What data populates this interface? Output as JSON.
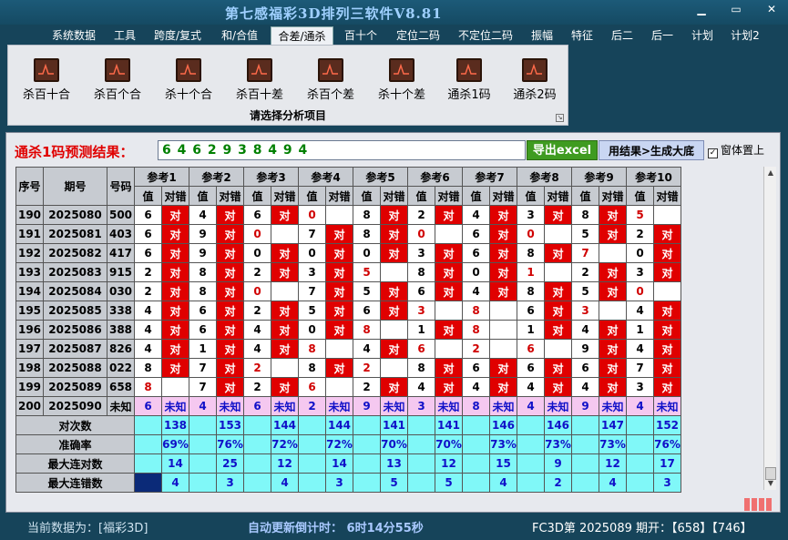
{
  "app": {
    "title": "第七感福彩3D排列三软件V8.81",
    "min_label": "▁",
    "restore_label": "▭",
    "close_label": "✕"
  },
  "menu": [
    "系统数据",
    "工具",
    "跨度/复式",
    "和/合值",
    "合差/通杀",
    "百十个",
    "定位二码",
    "不定位二码",
    "振幅",
    "特征",
    "后二",
    "后一",
    "计划",
    "计划2"
  ],
  "ribbon": {
    "buttons": [
      "杀百十合",
      "杀百个合",
      "杀十个合",
      "杀百十差",
      "杀百个差",
      "杀十个差",
      "通杀1码",
      "通杀2码"
    ],
    "caption": "请选择分析项目",
    "corner": "↘"
  },
  "prediction": {
    "label": "通杀1码预测结果：",
    "value": "6 4 6 2 9 3 8 4 9 4",
    "export_button": "导出excel",
    "result_button": "用结果>生成大底",
    "topmost_label": "窗体置上",
    "topmost_checked": "✓"
  },
  "table": {
    "h1": [
      "序号",
      "期号",
      "号码"
    ],
    "refs": [
      "参考1",
      "参考2",
      "参考3",
      "参考4",
      "参考5",
      "参考6",
      "参考7",
      "参考8",
      "参考9",
      "参考10"
    ],
    "sub": [
      "值",
      "对错"
    ],
    "rows": [
      {
        "seq": "190",
        "issue": "2025080",
        "num": "500",
        "cells": [
          [
            "6",
            "对"
          ],
          [
            "4",
            "对"
          ],
          [
            "6",
            "对"
          ],
          [
            "0",
            ""
          ],
          [
            "8",
            "对"
          ],
          [
            "2",
            "对"
          ],
          [
            "4",
            "对"
          ],
          [
            "3",
            "对"
          ],
          [
            "8",
            "对"
          ],
          [
            "5",
            ""
          ]
        ]
      },
      {
        "seq": "191",
        "issue": "2025081",
        "num": "403",
        "cells": [
          [
            "6",
            "对"
          ],
          [
            "9",
            "对"
          ],
          [
            "0",
            ""
          ],
          [
            "7",
            "对"
          ],
          [
            "8",
            "对"
          ],
          [
            "0",
            ""
          ],
          [
            "6",
            "对"
          ],
          [
            "0",
            ""
          ],
          [
            "5",
            "对"
          ],
          [
            "2",
            "对"
          ]
        ]
      },
      {
        "seq": "192",
        "issue": "2025082",
        "num": "417",
        "cells": [
          [
            "6",
            "对"
          ],
          [
            "9",
            "对"
          ],
          [
            "0",
            "对"
          ],
          [
            "0",
            "对"
          ],
          [
            "0",
            "对"
          ],
          [
            "3",
            "对"
          ],
          [
            "6",
            "对"
          ],
          [
            "8",
            "对"
          ],
          [
            "7",
            ""
          ],
          [
            "0",
            "对"
          ]
        ]
      },
      {
        "seq": "193",
        "issue": "2025083",
        "num": "915",
        "cells": [
          [
            "2",
            "对"
          ],
          [
            "8",
            "对"
          ],
          [
            "2",
            "对"
          ],
          [
            "3",
            "对"
          ],
          [
            "5",
            ""
          ],
          [
            "8",
            "对"
          ],
          [
            "0",
            "对"
          ],
          [
            "1",
            ""
          ],
          [
            "2",
            "对"
          ],
          [
            "3",
            "对"
          ]
        ]
      },
      {
        "seq": "194",
        "issue": "2025084",
        "num": "030",
        "cells": [
          [
            "2",
            "对"
          ],
          [
            "8",
            "对"
          ],
          [
            "0",
            ""
          ],
          [
            "7",
            "对"
          ],
          [
            "5",
            "对"
          ],
          [
            "6",
            "对"
          ],
          [
            "4",
            "对"
          ],
          [
            "8",
            "对"
          ],
          [
            "5",
            "对"
          ],
          [
            "0",
            ""
          ]
        ]
      },
      {
        "seq": "195",
        "issue": "2025085",
        "num": "338",
        "cells": [
          [
            "4",
            "对"
          ],
          [
            "6",
            "对"
          ],
          [
            "2",
            "对"
          ],
          [
            "5",
            "对"
          ],
          [
            "6",
            "对"
          ],
          [
            "3",
            ""
          ],
          [
            "8",
            ""
          ],
          [
            "6",
            "对"
          ],
          [
            "3",
            ""
          ],
          [
            "4",
            "对"
          ]
        ]
      },
      {
        "seq": "196",
        "issue": "2025086",
        "num": "388",
        "cells": [
          [
            "4",
            "对"
          ],
          [
            "6",
            "对"
          ],
          [
            "4",
            "对"
          ],
          [
            "0",
            "对"
          ],
          [
            "8",
            ""
          ],
          [
            "1",
            "对"
          ],
          [
            "8",
            ""
          ],
          [
            "1",
            "对"
          ],
          [
            "4",
            "对"
          ],
          [
            "1",
            "对"
          ]
        ]
      },
      {
        "seq": "197",
        "issue": "2025087",
        "num": "826",
        "cells": [
          [
            "4",
            "对"
          ],
          [
            "1",
            "对"
          ],
          [
            "4",
            "对"
          ],
          [
            "8",
            ""
          ],
          [
            "4",
            "对"
          ],
          [
            "6",
            ""
          ],
          [
            "2",
            ""
          ],
          [
            "6",
            ""
          ],
          [
            "9",
            "对"
          ],
          [
            "4",
            "对"
          ]
        ]
      },
      {
        "seq": "198",
        "issue": "2025088",
        "num": "022",
        "cells": [
          [
            "8",
            "对"
          ],
          [
            "7",
            "对"
          ],
          [
            "2",
            ""
          ],
          [
            "8",
            "对"
          ],
          [
            "2",
            ""
          ],
          [
            "8",
            "对"
          ],
          [
            "6",
            "对"
          ],
          [
            "6",
            "对"
          ],
          [
            "6",
            "对"
          ],
          [
            "7",
            "对"
          ]
        ]
      },
      {
        "seq": "199",
        "issue": "2025089",
        "num": "658",
        "cells": [
          [
            "8",
            ""
          ],
          [
            "7",
            "对"
          ],
          [
            "2",
            "对"
          ],
          [
            "6",
            ""
          ],
          [
            "2",
            "对"
          ],
          [
            "4",
            "对"
          ],
          [
            "4",
            "对"
          ],
          [
            "4",
            "对"
          ],
          [
            "4",
            "对"
          ],
          [
            "3",
            "对"
          ]
        ]
      },
      {
        "seq": "200",
        "issue": "2025090",
        "num": "未知",
        "cells": [
          [
            "6",
            "未知"
          ],
          [
            "4",
            "未知"
          ],
          [
            "6",
            "未知"
          ],
          [
            "2",
            "未知"
          ],
          [
            "9",
            "未知"
          ],
          [
            "3",
            "未知"
          ],
          [
            "8",
            "未知"
          ],
          [
            "4",
            "未知"
          ],
          [
            "9",
            "未知"
          ],
          [
            "4",
            "未知"
          ]
        ]
      }
    ],
    "stats": [
      {
        "label": "对次数",
        "values": [
          "138",
          "153",
          "144",
          "144",
          "141",
          "141",
          "146",
          "146",
          "147",
          "152"
        ]
      },
      {
        "label": "准确率",
        "values": [
          "69%",
          "76%",
          "72%",
          "72%",
          "70%",
          "70%",
          "73%",
          "73%",
          "73%",
          "76%"
        ]
      },
      {
        "label": "最大连对数",
        "values": [
          "14",
          "25",
          "12",
          "14",
          "13",
          "12",
          "15",
          "9",
          "12",
          "17"
        ]
      },
      {
        "label": "最大连错数",
        "values": [
          "4",
          "3",
          "4",
          "3",
          "5",
          "5",
          "4",
          "2",
          "4",
          "3"
        ]
      }
    ]
  },
  "scroll": {
    "up": "▲",
    "down": "▼"
  },
  "status": {
    "data_label": "当前数据为：[福彩3D]",
    "countdown": "自动更新倒计时：  6时14分55秒",
    "issue": "FC3D第 2025089 期开：【658】【746】"
  }
}
